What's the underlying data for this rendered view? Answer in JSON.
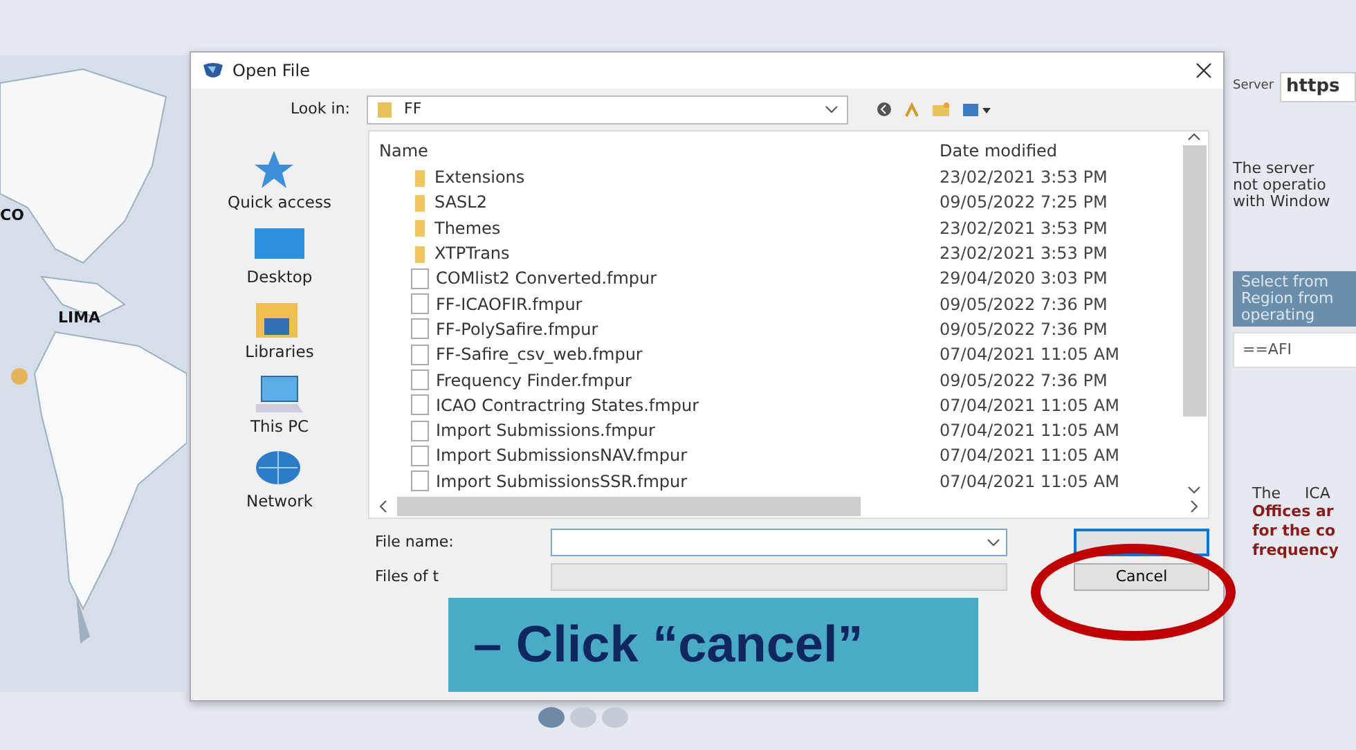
{
  "map_labels": [
    "CO",
    "LIMA"
  ],
  "dialog": {
    "title": "Open File",
    "look_in_label": "Look in:",
    "look_in_value": "FF",
    "places": [
      {
        "label": "Quick access",
        "kind": "star"
      },
      {
        "label": "Desktop",
        "kind": "desktop"
      },
      {
        "label": "Libraries",
        "kind": "libraries"
      },
      {
        "label": "This PC",
        "kind": "pc"
      },
      {
        "label": "Network",
        "kind": "network"
      }
    ],
    "columns": [
      "Name",
      "Date modified"
    ],
    "files": [
      {
        "name": "Extensions",
        "date": "23/02/2021 3:53 PM",
        "kind": "folder"
      },
      {
        "name": "SASL2",
        "date": "09/05/2022 7:25 PM",
        "kind": "folder"
      },
      {
        "name": "Themes",
        "date": "23/02/2021 3:53 PM",
        "kind": "folder"
      },
      {
        "name": "XTPTrans",
        "date": "23/02/2021 3:53 PM",
        "kind": "folder"
      },
      {
        "name": "COMlist2 Converted.fmpur",
        "date": "29/04/2020 3:03 PM",
        "kind": "file"
      },
      {
        "name": "FF-ICAOFIR.fmpur",
        "date": "09/05/2022 7:36 PM",
        "kind": "file"
      },
      {
        "name": "FF-PolySafire.fmpur",
        "date": "09/05/2022 7:36 PM",
        "kind": "file"
      },
      {
        "name": "FF-Safire_csv_web.fmpur",
        "date": "07/04/2021 11:05 AM",
        "kind": "file"
      },
      {
        "name": "Frequency Finder.fmpur",
        "date": "09/05/2022 7:36 PM",
        "kind": "file"
      },
      {
        "name": "ICAO Contractring States.fmpur",
        "date": "07/04/2021 11:05 AM",
        "kind": "file"
      },
      {
        "name": "Import Submissions.fmpur",
        "date": "07/04/2021 11:05 AM",
        "kind": "file"
      },
      {
        "name": "Import SubmissionsNAV.fmpur",
        "date": "07/04/2021 11:05 AM",
        "kind": "file"
      },
      {
        "name": "Import SubmissionsSSR.fmpur",
        "date": "07/04/2021 11:05 AM",
        "kind": "file"
      }
    ],
    "file_name_label": "File name:",
    "files_of_type_label": "Files of t",
    "cancel_button": "Cancel"
  },
  "callout": "– Click “cancel”",
  "carousel_dots": [
    {
      "selected": true
    },
    {
      "selected": false
    },
    {
      "selected": false
    }
  ],
  "side_panel": {
    "server_label": "Server",
    "server_value": "https",
    "notice": "The server\nnot operatio\nwith Window",
    "region_prompt": "Select from\nRegion from\noperating",
    "region_value": "==AFI",
    "info_intro": "The     ICA",
    "info_emphasis": "Offices ar\nfor the co\nfrequency"
  }
}
